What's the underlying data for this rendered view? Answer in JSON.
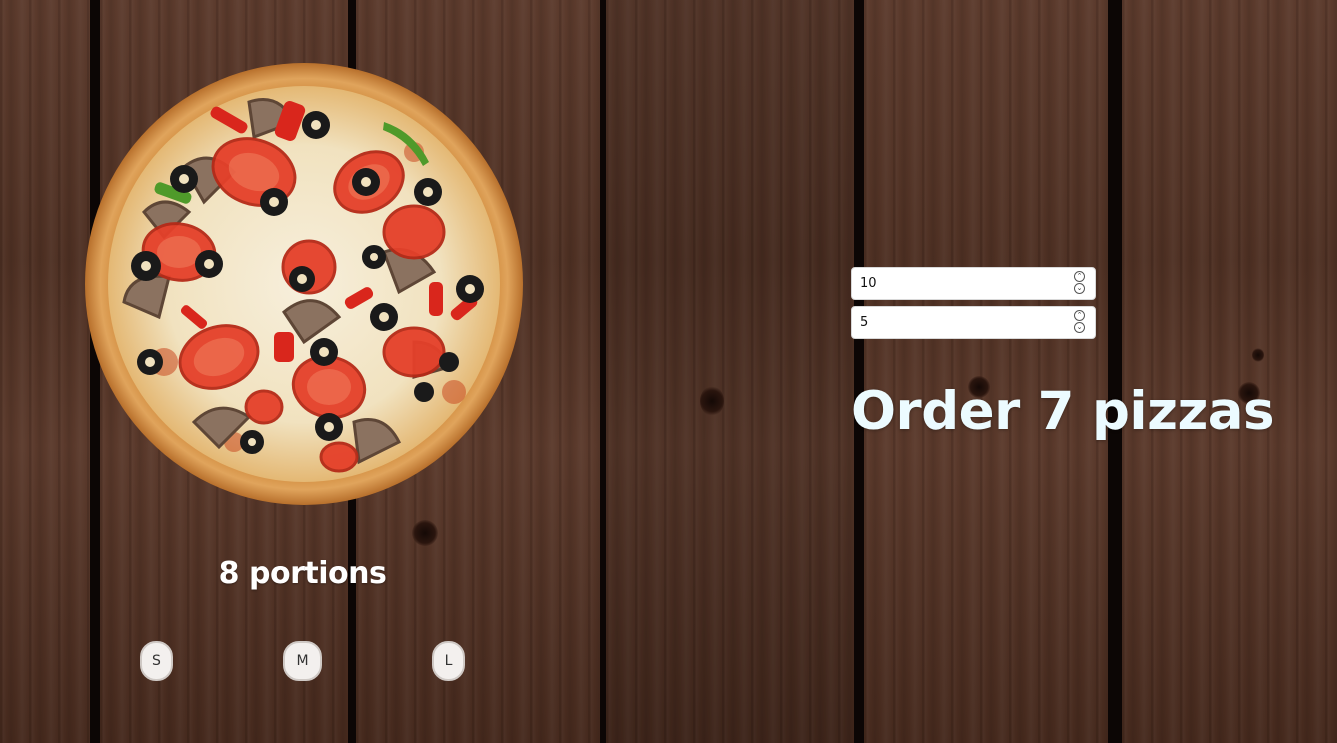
{
  "pizza": {
    "portions_text": "8 portions",
    "image_icon": "pizza-image"
  },
  "sizes": [
    {
      "label": "S"
    },
    {
      "label": "M"
    },
    {
      "label": "L"
    }
  ],
  "inputs": {
    "people": {
      "value": "10"
    },
    "slices_per_person": {
      "value": "5"
    }
  },
  "order": {
    "text": "Order 7 pizzas"
  },
  "colors": {
    "wood": "#4e3023",
    "text": "#ffffff",
    "order_text": "#ecfbff"
  }
}
